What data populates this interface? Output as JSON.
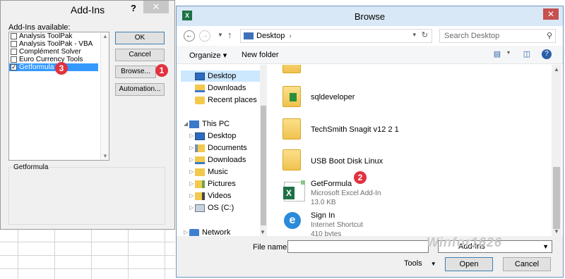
{
  "addins": {
    "title": "Add-Ins",
    "help": "?",
    "close": "✕",
    "available_label": "Add-Ins available:",
    "items": [
      {
        "label": "Analysis ToolPak",
        "checked": false
      },
      {
        "label": "Analysis ToolPak - VBA",
        "checked": false
      },
      {
        "label": "Complément Solver",
        "checked": false
      },
      {
        "label": "Euro Currency Tools",
        "checked": false
      },
      {
        "label": "Getformula",
        "checked": true
      }
    ],
    "ok": "OK",
    "cancel": "Cancel",
    "browse": "Browse...",
    "automation": "Automation...",
    "group_label": "Getformula",
    "check": "✓"
  },
  "badges": {
    "one": "1",
    "two": "2",
    "three": "3"
  },
  "browse": {
    "title": "Browse",
    "app_icon": "X",
    "close": "✕",
    "address": "Desktop",
    "search_placeholder": "Search Desktop",
    "organize": "Organize ▾",
    "new_folder": "New folder",
    "nav": {
      "desktop": "Desktop",
      "downloads": "Downloads",
      "recent": "Recent places",
      "this_pc": "This PC",
      "pc_desktop": "Desktop",
      "documents": "Documents",
      "pc_downloads": "Downloads",
      "music": "Music",
      "pictures": "Pictures",
      "videos": "Videos",
      "os": "OS (C:)",
      "network": "Network"
    },
    "files": {
      "sqldeveloper": "sqldeveloper",
      "snagit": "TechSmith Snagit v12 2 1",
      "usb": "USB Boot Disk Linux",
      "getformula": "GetFormula",
      "getformula_type": "Microsoft Excel Add-In",
      "getformula_size": "13.0 KB",
      "signin": "Sign In",
      "signin_type": "Internet Shortcut",
      "signin_size": "410 bytes"
    },
    "file_name_label": "File name:",
    "filter_value": "Add-Ins",
    "tools": "Tools",
    "open": "Open",
    "cancel": "Cancel"
  },
  "watermark": "Winfor1626"
}
